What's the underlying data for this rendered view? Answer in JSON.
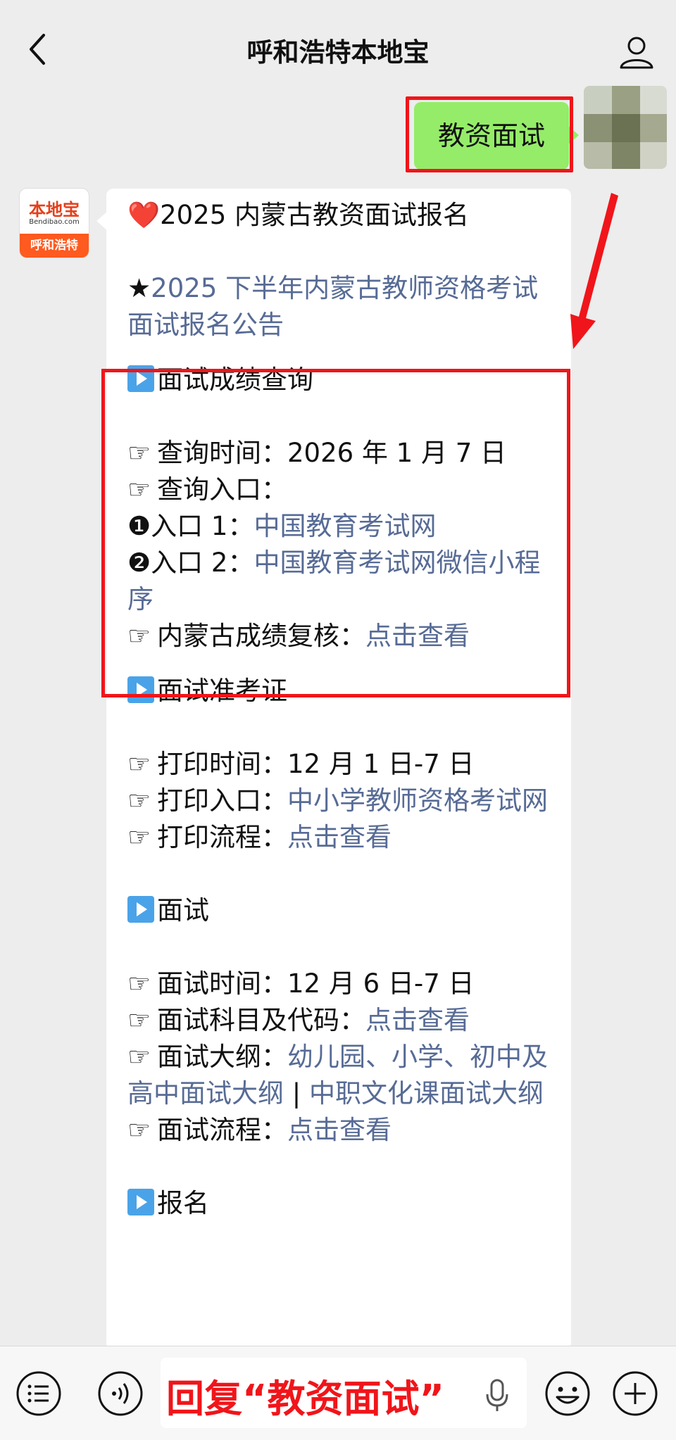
{
  "header": {
    "title": "呼和浩特本地宝"
  },
  "sent_message": {
    "text": "教资面试"
  },
  "bot_avatar": {
    "logo_top": "本地宝",
    "logo_mid": "Bendibao.com",
    "logo_bottom": "呼和浩特"
  },
  "message": {
    "heart": "❤️",
    "headline": "2025 内蒙古教资面试报名",
    "star": "★",
    "notice_link": "2025 下半年内蒙古教师资格考试面试报名公告",
    "sections": {
      "score": {
        "title": "面试成绩查询",
        "time_label": "查询时间：",
        "time_value": "2026 年 1 月 7 日",
        "entry_label": "查询入口：",
        "entry1_label": "入口 1：",
        "entry1_link": "中国教育考试网",
        "entry2_label": "入口 2：",
        "entry2_link": "中国教育考试网微信小程序",
        "review_label": "内蒙古成绩复核：",
        "review_link": "点击查看"
      },
      "ticket": {
        "title": "面试准考证",
        "time_label": "打印时间：",
        "time_value": "12 月 1 日-7 日",
        "entry_label": "打印入口：",
        "entry_link": "中小学教师资格考试网",
        "flow_label": "打印流程：",
        "flow_link": "点击查看"
      },
      "interview": {
        "title": "面试",
        "time_label": "面试时间：",
        "time_value": "12 月 6 日-7 日",
        "subject_label": "面试科目及代码：",
        "subject_link": "点击查看",
        "outline_label": "面试大纲：",
        "outline_link1": "幼儿园、小学、初中及高中面试大纲",
        "outline_sep": " | ",
        "outline_link2": "中职文化课面试大纲",
        "flow_label": "面试流程：",
        "flow_link": "点击查看"
      },
      "signup": {
        "title": "报名"
      }
    },
    "point_symbol": "☞",
    "num1": "❶",
    "num2": "❷"
  },
  "input_bar": {
    "text": "回复“教资面试”"
  },
  "colors": {
    "highlight": "#f0151a",
    "link": "#576b95",
    "sent_bubble": "#95ec69"
  }
}
